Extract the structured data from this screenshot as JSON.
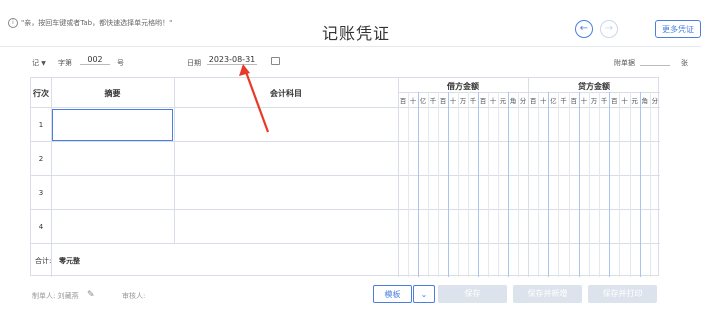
{
  "header": {
    "hint_text": "\"亲，按回车键或者Tab，都快速选择单元格哟！\"",
    "title": "记账凭证",
    "prev_icon": "arrow-left",
    "next_icon": "arrow-right",
    "more_button": "更多凭证"
  },
  "voucher": {
    "word_select": "记",
    "word_label": "字第",
    "number": "002",
    "number_suffix": "号",
    "date_label": "日期",
    "date_value": "2023-08-31",
    "attachment_label": "附单据",
    "attachment_unit": "张"
  },
  "table": {
    "headers": {
      "row_no": "行次",
      "summary": "摘要",
      "account": "会计科目",
      "debit": "借方金额",
      "credit": "贷方金额"
    },
    "digit_units": [
      "百",
      "十",
      "亿",
      "千",
      "百",
      "十",
      "万",
      "千",
      "百",
      "十",
      "元",
      "角",
      "分"
    ],
    "rows": [
      "1",
      "2",
      "3",
      "4"
    ],
    "total_label": "合计:",
    "total_value": "零元整"
  },
  "footer": {
    "preparer_label": "制单人: 刘藏燕",
    "reviewer_label": "审核人:",
    "template_button": "模板",
    "save_button": "保存",
    "save_new_button": "保存并新增",
    "save_print_button": "保存并打印"
  },
  "colors": {
    "accent": "#4a7fe0",
    "annotation": "#e83a2a"
  }
}
